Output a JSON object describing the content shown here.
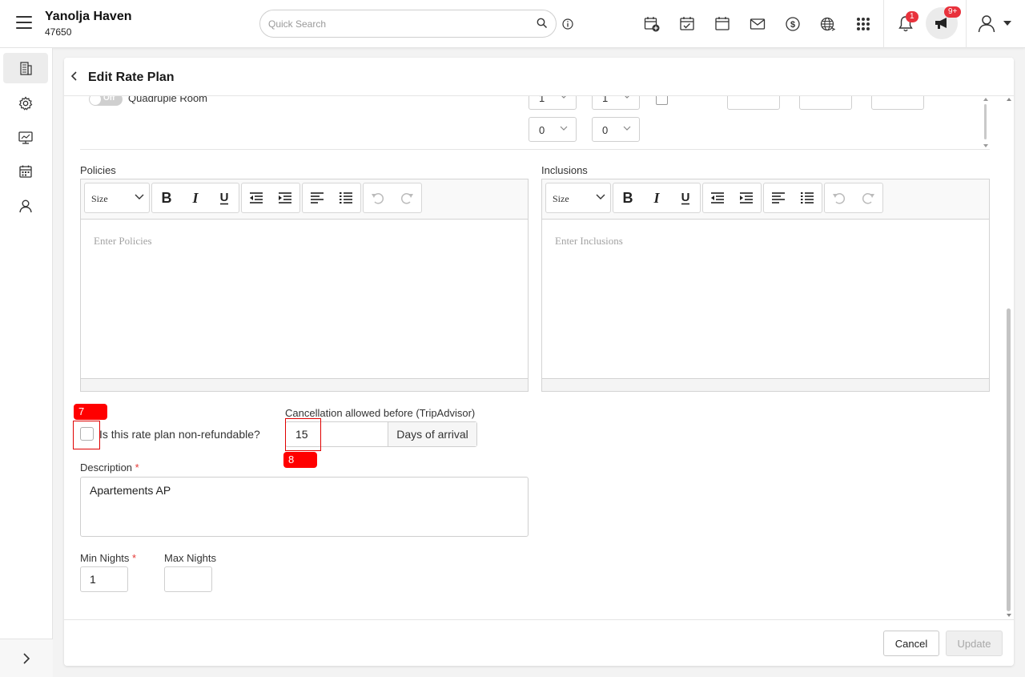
{
  "header": {
    "hotel_name": "Yanolja Haven",
    "hotel_id": "47650",
    "search_placeholder": "Quick Search",
    "notifications_count": "1",
    "announcements_count": "9+",
    "icons": [
      "menu-icon",
      "search-icon",
      "info-icon",
      "calendar-add-icon",
      "calendar-check-icon",
      "calendar-icon",
      "mail-icon",
      "dollar-icon",
      "globe-icon",
      "apps-grid-icon",
      "bell-icon",
      "megaphone-icon",
      "user-icon",
      "caret-down-icon"
    ]
  },
  "sidebar": {
    "items": [
      "building-icon",
      "settings-icon",
      "monitor-icon",
      "calendar-grid-icon",
      "person-icon"
    ],
    "active_index": 0,
    "expand_icon": "chevron-right-icon"
  },
  "page": {
    "title": "Edit Rate Plan"
  },
  "room_row": {
    "toggle_label": "Off",
    "room_name": "Quadruple Room",
    "selects_top": [
      "1",
      "1"
    ],
    "selects_bottom": [
      "0",
      "0"
    ]
  },
  "policies": {
    "label": "Policies",
    "size_label": "Size",
    "placeholder": "Enter Policies"
  },
  "inclusions": {
    "label": "Inclusions",
    "size_label": "Size",
    "placeholder": "Enter Inclusions"
  },
  "refund": {
    "label": "Is this rate plan non-refundable?",
    "checked": false
  },
  "cancellation": {
    "label": "Cancellation allowed before (TripAdvisor)",
    "value": "15",
    "addon": "Days of arrival"
  },
  "description": {
    "label": "Description",
    "required_mark": "*",
    "value": "Apartements AP"
  },
  "min_nights": {
    "label": "Min Nights",
    "required_mark": "*",
    "value": "1"
  },
  "max_nights": {
    "label": "Max Nights",
    "value": ""
  },
  "markers": {
    "refund_tag": "7",
    "cancellation_tag": "8"
  },
  "footer": {
    "cancel_label": "Cancel",
    "update_label": "Update"
  },
  "colors": {
    "badge": "#e8323c",
    "marker": "#ff0000",
    "required": "#e53935"
  }
}
